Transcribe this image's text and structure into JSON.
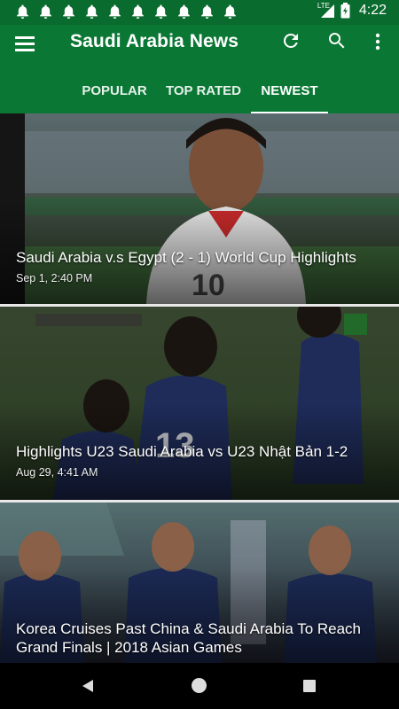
{
  "status_bar": {
    "notification_icons": [
      "bell-icon",
      "bell-icon",
      "bell-icon",
      "bell-icon",
      "bell-icon",
      "bell-icon",
      "bell-icon",
      "bell-icon",
      "bell-icon",
      "bell-icon"
    ],
    "network": "LTE",
    "time": "4:22"
  },
  "app_bar": {
    "title": "Saudi Arabia News",
    "actions": [
      "refresh-icon",
      "search-icon",
      "more-vert-icon"
    ]
  },
  "tabs": [
    {
      "label": "POPULAR"
    },
    {
      "label": "TOP RATED"
    },
    {
      "label": "NEWEST",
      "selected": true
    }
  ],
  "feed": [
    {
      "title": "Saudi Arabia v.s Egypt (2 - 1) World Cup Highlights",
      "date": "Sep 1, 2:40 PM"
    },
    {
      "title": "Highlights U23 Saudi Arabia vs U23 Nhật Bản 1-2",
      "date": "Aug 29, 4:41 AM"
    },
    {
      "title": "Korea Cruises Past China & Saudi Arabia To Reach Grand Finals | 2018 Asian Games",
      "date": ""
    }
  ],
  "colors": {
    "status_bar": "#0a6b2f",
    "app_bar": "#0a7734",
    "nav_bar": "#000000"
  }
}
